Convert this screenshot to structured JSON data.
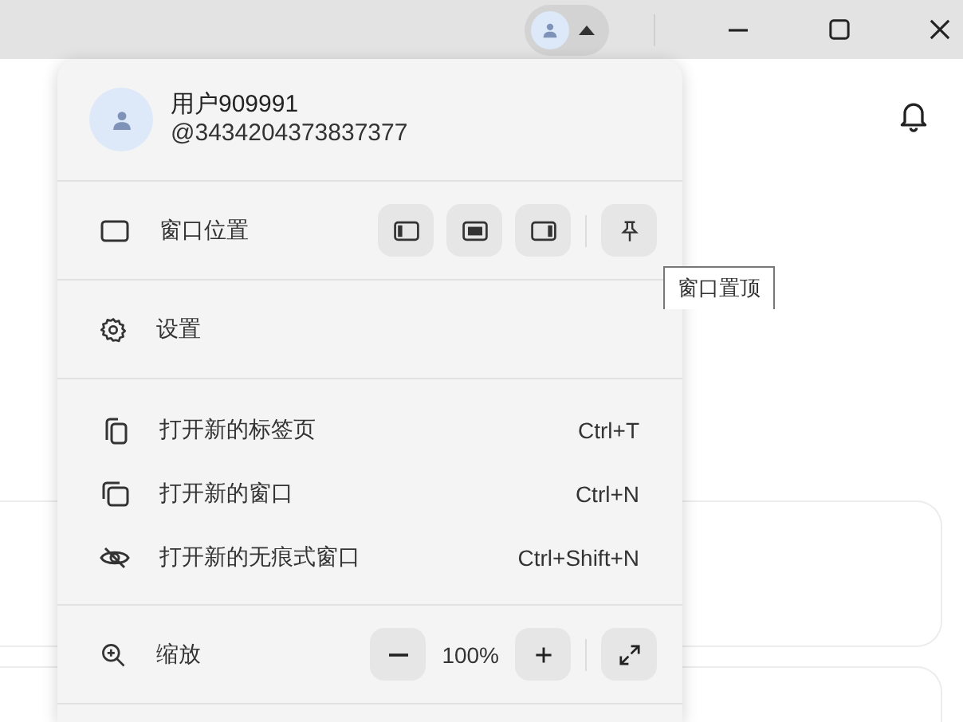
{
  "title_bar": {
    "profile_chip": {
      "expanded": true
    }
  },
  "menu": {
    "user": {
      "name": "用户909991",
      "handle": "@3434204373837377"
    },
    "window_position": {
      "label": "窗口位置",
      "tooltip": "窗口置顶"
    },
    "settings": {
      "label": "设置"
    },
    "open_items": [
      {
        "kind": "tab",
        "label": "打开新的标签页",
        "shortcut": "Ctrl+T"
      },
      {
        "kind": "window",
        "label": "打开新的窗口",
        "shortcut": "Ctrl+N"
      },
      {
        "kind": "incognito",
        "label": "打开新的无痕式窗口",
        "shortcut": "Ctrl+Shift+N"
      }
    ],
    "zoom": {
      "label": "缩放",
      "value": "100%"
    }
  }
}
